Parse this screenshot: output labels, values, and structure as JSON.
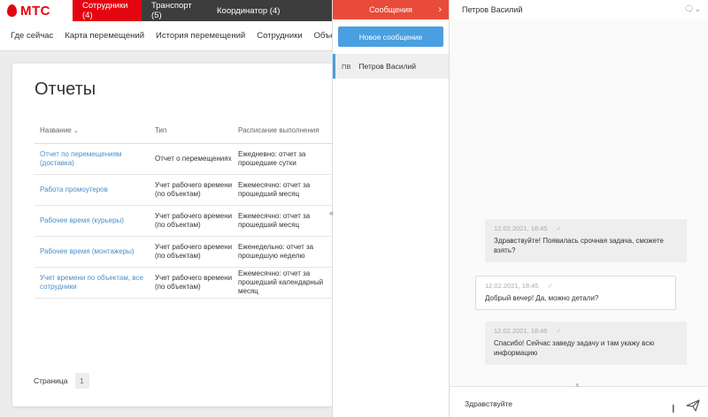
{
  "brand": {
    "logo_text": "МТС",
    "color": "#e30611"
  },
  "top_tabs": [
    {
      "label": "Сотрудники (4)"
    },
    {
      "label": "Транспорт (5)"
    },
    {
      "label": "Координатор (4)"
    }
  ],
  "subnav": [
    "Где сейчас",
    "Карта перемещений",
    "История перемещений",
    "Сотрудники",
    "Объекты"
  ],
  "reports": {
    "title": "Отчеты",
    "columns": [
      "Название",
      "Тип",
      "Расписание выполнения"
    ],
    "rows": [
      {
        "name": "Отчет по перемещениям (доставка)",
        "type": "Отчет о перемещениях",
        "schedule": "Ежедневно: отчет за прошедшие сутки"
      },
      {
        "name": "Работа промоутеров",
        "type": "Учет рабочего времени (по объектам)",
        "schedule": "Ежемесячно: отчет за прошедший месяц"
      },
      {
        "name": "Рабочее время (курьеры)",
        "type": "Учет рабочего времени (по объектам)",
        "schedule": "Ежемесячно: отчет за прошедший месяц"
      },
      {
        "name": "Рабочее время (монтажеры)",
        "type": "Учет рабочего времени (по объектам)",
        "schedule": "Еженедельно: отчет за прошедшую неделю"
      },
      {
        "name": "Учет времени по объектам, все сотрудники",
        "type": "Учет рабочего времени (по объектам)",
        "schedule": "Ежемесячно: отчет за прошедший календарный месяц"
      }
    ],
    "pager": {
      "label": "Страница",
      "page": "1"
    }
  },
  "messages": {
    "header": "Сообщения",
    "new_button": "Новое сообщение",
    "conversations": [
      {
        "initials": "ПВ",
        "name": "Петров Василий"
      }
    ]
  },
  "chat": {
    "contact": "Петров Василий",
    "bubbles": [
      {
        "time": "12.02.2021, 18:45",
        "text": "Здравствуйте! Появилась срочная задача, сможете взять?",
        "direction": "in"
      },
      {
        "time": "12.02.2021, 18:45",
        "text": "Добрый вечер! Да, можно детали?",
        "direction": "out"
      },
      {
        "time": "12.02.2021, 18:46",
        "text": "Спасибо! Сейчас заведу задачу и там укажу всю информацию",
        "direction": "in"
      }
    ],
    "input_value": "Здравствуйте"
  }
}
